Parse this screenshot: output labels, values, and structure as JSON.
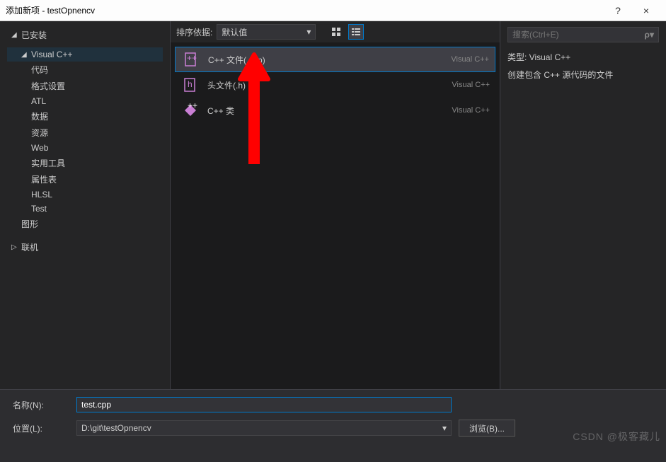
{
  "window": {
    "title": "添加新项 - testOpnencv",
    "help": "?",
    "close": "×"
  },
  "sidebar": {
    "installed": "已安装",
    "vcpp": "Visual C++",
    "items": [
      "代码",
      "格式设置",
      "ATL",
      "数据",
      "资源",
      "Web",
      "实用工具",
      "属性表",
      "HLSL",
      "Test"
    ],
    "graphics": "图形",
    "online": "联机"
  },
  "toolbar": {
    "sort_label": "排序依据:",
    "sort_value": "默认值"
  },
  "list": {
    "items": [
      {
        "name": "C++ 文件(.cpp)",
        "cat": "Visual C++"
      },
      {
        "name": "头文件(.h)",
        "cat": "Visual C++"
      },
      {
        "name": "C++ 类",
        "cat": "Visual C++"
      }
    ]
  },
  "search": {
    "placeholder": "搜索(Ctrl+E)"
  },
  "detail": {
    "type_label": "类型:  Visual C++",
    "desc": "创建包含 C++ 源代码的文件"
  },
  "bottom": {
    "name_label": "名称(N):",
    "name_value": "test.cpp",
    "loc_label": "位置(L):",
    "loc_value": "D:\\git\\testOpnencv",
    "browse": "浏览(B)..."
  },
  "watermark": "CSDN @极客藏儿"
}
